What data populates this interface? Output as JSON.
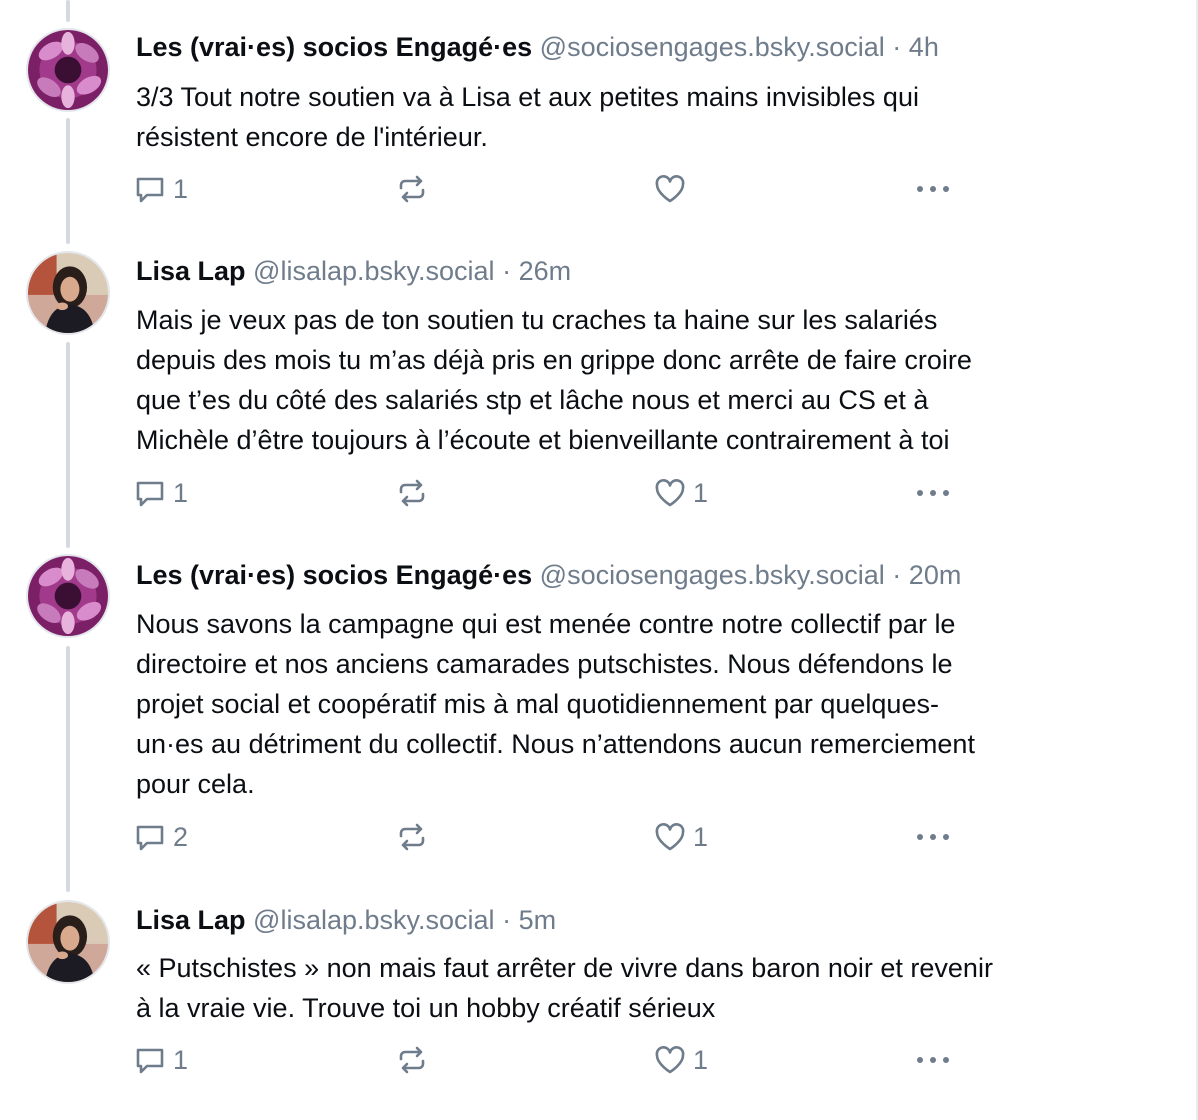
{
  "posts": [
    {
      "author": "Les (vrai·es) socios Engagé·es",
      "handle": "@sociosengages.bsky.social",
      "separator": "·",
      "time": "4h",
      "avatar": "socios-hands-avatar",
      "lines": [
        "3/3 Tout notre soutien va à Lisa et aux petites mains invisibles qui",
        "résistent encore de l'intérieur."
      ],
      "replies": "1",
      "reposts": "",
      "likes": ""
    },
    {
      "author": "Lisa Lap",
      "handle": "@lisalap.bsky.social",
      "separator": "·",
      "time": "26m",
      "avatar": "lisa-portrait-avatar",
      "lines": [
        "Mais je veux pas de ton soutien tu craches ta haine sur les salariés",
        "depuis des mois tu m’as déjà pris en grippe donc arrête de faire croire",
        "que t’es du côté des salariés stp et lâche nous et merci au CS et à",
        "Michèle d’être toujours à l’écoute et bienveillante contrairement à toi"
      ],
      "replies": "1",
      "reposts": "",
      "likes": "1"
    },
    {
      "author": "Les (vrai·es) socios Engagé·es",
      "handle": "@sociosengages.bsky.social",
      "separator": "·",
      "time": "20m",
      "avatar": "socios-hands-avatar",
      "lines": [
        "Nous savons la campagne qui est menée contre notre collectif par le",
        "directoire et nos anciens camarades putschistes. Nous défendons le",
        "projet social et coopératif mis à mal quotidiennement par quelques-",
        "un·es au détriment du collectif. Nous n’attendons aucun remerciement",
        "pour cela."
      ],
      "replies": "2",
      "reposts": "",
      "likes": "1"
    },
    {
      "author": "Lisa Lap",
      "handle": "@lisalap.bsky.social",
      "separator": "·",
      "time": "5m",
      "avatar": "lisa-portrait-avatar",
      "lines": [
        "« Putschistes » non mais faut arrêter de vivre dans baron noir et revenir",
        "à la vraie vie. Trouve toi un hobby créatif sérieux"
      ],
      "replies": "1",
      "reposts": "",
      "likes": "1"
    }
  ],
  "icons": {
    "reply": "speech-bubble-icon",
    "repost": "repost-arrows-icon",
    "like": "heart-icon",
    "more": "ellipsis-icon"
  },
  "colors": {
    "text": "#0b0f14",
    "muted": "#6f7c8b",
    "thread_line": "#d4dae1",
    "socios_avatar": "#8a2a74"
  }
}
